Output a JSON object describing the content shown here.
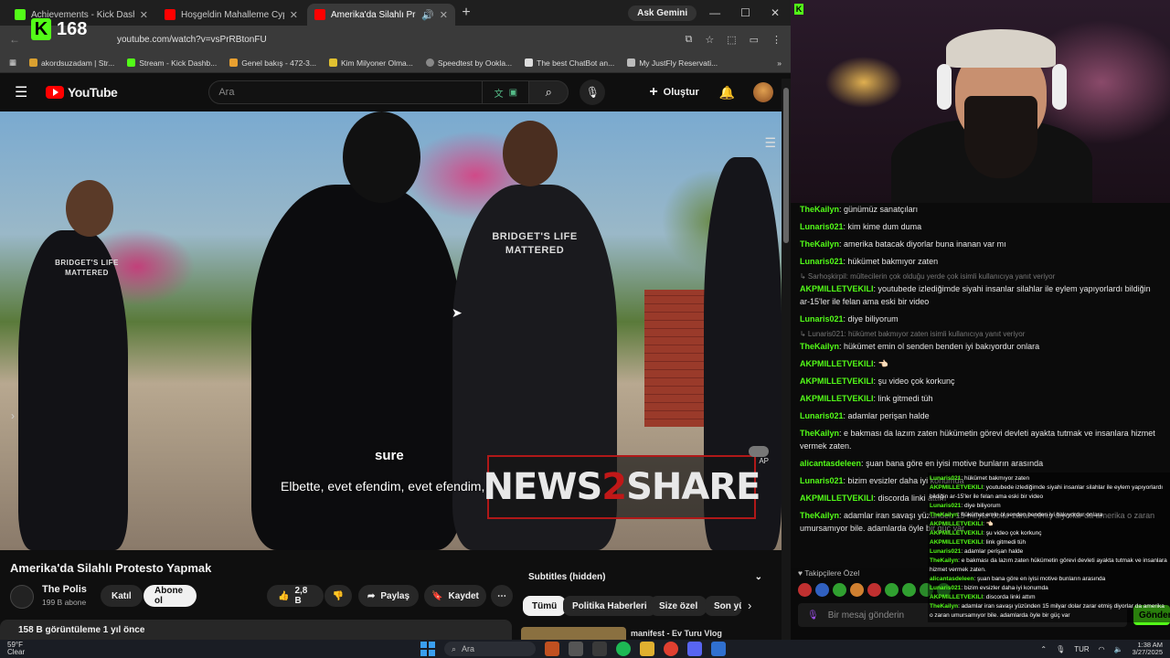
{
  "browser": {
    "tabs": [
      {
        "title": "Achievements - Kick Dashboard",
        "color": "#53fc18"
      },
      {
        "title": "Hoşgeldin Mahalleme Cypher -",
        "color": "#ff0000"
      },
      {
        "title": "Amerika'da Silahlı Protesto",
        "color": "#ff0000"
      }
    ],
    "ask_gemini": "Ask Gemini",
    "kick_badge": {
      "letter": "K",
      "count": "168"
    },
    "url": "youtube.com/watch?v=vsPrRBtonFU",
    "bookmarks": [
      "akordsuzadam | Str...",
      "Stream - Kick Dashb...",
      "Genel bakış - 472-3...",
      "Kim Milyoner Olma...",
      "Speedtest by Ookla...",
      "The best ChatBot an...",
      "My JustFly Reservati..."
    ]
  },
  "youtube": {
    "logo_text": "YouTube",
    "search_placeholder": "Ara",
    "create_label": "Oluştur",
    "video": {
      "subtitle_line1": "sure",
      "subtitle_line2": "Elbette, evet efendim, evet efendim,",
      "watermark_left": "NEWS",
      "watermark_num": "2",
      "watermark_right": "SHARE",
      "shirt_text_1": "BRIDGET'S LIFE MATTERED",
      "shirt_text_2": "BRIDGET'S LIFE MATTERED",
      "autoplay_label": "AP"
    },
    "title": "Amerika'da Silahlı Protesto Yapmak",
    "channel": {
      "name": "The Polis",
      "subscribers": "199 B abone"
    },
    "join_label": "Katıl",
    "subscribe_label": "Abone ol",
    "like_count": "2,8 B",
    "share_label": "Paylaş",
    "save_label": "Kaydet",
    "views_line": "158 B görüntüleme  1 yıl önce",
    "subtitles_panel": "Subtitles (hidden)",
    "chips": [
      "Tümü",
      "Politika Haberleri",
      "Size özel",
      "Son yü"
    ],
    "rec_title": "manifest - Ev Turu Vlog"
  },
  "chat": {
    "messages": [
      {
        "user": "TheKailyn",
        "color": "#53fc18",
        "text": "günümüz sanatçıları"
      },
      {
        "user": "Lunaris021",
        "color": "#53fc18",
        "text": "kim kime dum duma"
      },
      {
        "user": "TheKailyn",
        "color": "#53fc18",
        "text": "amerika batacak diyorlar buna inanan var mı"
      },
      {
        "user": "Lunaris021",
        "color": "#53fc18",
        "text": "hükümet bakmıyor zaten"
      },
      {
        "reply": "↳ Sarhoşkirpil: mültecilerin çok olduğu yerde çok isimli kullanıcıya yanıt veriyor"
      },
      {
        "user": "AKPMILLETVEKILI",
        "color": "#53fc18",
        "text": "youtubede izlediğimde siyahi insanlar silahlar ile eylem yapıyorlardı bildiğin ar-15'ler ile felan ama eski bir video"
      },
      {
        "user": "Lunaris021",
        "color": "#53fc18",
        "text": "diye biliyorum"
      },
      {
        "reply": "↳ Lunaris021: hükümet bakmıyor zaten isimli kullanıcıya yanıt veriyor"
      },
      {
        "user": "TheKailyn",
        "color": "#53fc18",
        "text": "hükümet emin ol senden benden iyi bakıyordur onlara"
      },
      {
        "user": "AKPMILLETVEKILI",
        "color": "#53fc18",
        "text": "👈🏻"
      },
      {
        "user": "AKPMILLETVEKILI",
        "color": "#53fc18",
        "text": "şu video çok korkunç"
      },
      {
        "user": "AKPMILLETVEKILI",
        "color": "#53fc18",
        "text": "link gitmedi tüh"
      },
      {
        "user": "Lunaris021",
        "color": "#53fc18",
        "text": "adamlar perişan halde"
      },
      {
        "user": "TheKailyn",
        "color": "#53fc18",
        "text": "e bakması da lazım zaten hükümetin görevi devleti ayakta tutmak ve insanlara hizmet vermek zaten."
      },
      {
        "user": "alicantasdeleen",
        "color": "#53fc18",
        "text": "şuan bana göre en iyisi motive bunların arasında"
      },
      {
        "user": "Lunaris021",
        "color": "#53fc18",
        "text": "bizim evsizler daha iyi konumda"
      },
      {
        "user": "AKPMILLETVEKILI",
        "color": "#53fc18",
        "text": "discorda linki attım"
      },
      {
        "user": "TheKailyn",
        "color": "#53fc18",
        "text": "adamlar iran savaşı yüzünden 15 milyar dolar zarar etmiş diyorlar da amerika o zaran umursamıyor bile. adamlarda öyle bir güç var"
      }
    ],
    "overlay": [
      {
        "user": "Lunaris021",
        "text": "hükümet bakmıyor zaten"
      },
      {
        "user": "AKPMILLETVEKILI",
        "text": "youtubede izlediğimde siyahi insanlar silahlar ile eylem yapıyorlardı bildiğin ar-15'ler ile felan ama eski bir video"
      },
      {
        "user": "Lunaris021",
        "text": "diye biliyorum"
      },
      {
        "user": "TheKailyn",
        "text": "hükümet emin ol senden benden iyi bakıyordur onlara"
      },
      {
        "user": "AKPMILLETVEKILI",
        "text": "👈🏻"
      },
      {
        "user": "AKPMILLETVEKILI",
        "text": "şu video çok korkunç"
      },
      {
        "user": "AKPMILLETVEKILI",
        "text": "link gitmedi tüh"
      },
      {
        "user": "Lunaris021",
        "text": "adamlar perişan halde"
      },
      {
        "user": "TheKailyn",
        "text": "e bakması da lazım zaten hükümetin görevi devleti ayakta tutmak ve insanlara hizmet vermek zaten."
      },
      {
        "user": "alicantasdeleen",
        "text": "şuan bana göre en iyisi motive bunların arasında"
      },
      {
        "user": "Lunaris021",
        "text": "bizim evsizler daha iyi konumda"
      },
      {
        "user": "AKPMILLETVEKILI",
        "text": "discorda linki attım"
      },
      {
        "user": "TheKailyn",
        "text": "adamlar iran savaşı yüzünden 15 milyar dolar zarar etmiş diyorlar da amerika o zaran umursamıyor bile. adamlarda öyle bir güç var"
      }
    ],
    "followers_only_label": "Takipçilere Özel",
    "input_placeholder": "Bir mesaj gönderin",
    "send_label": "Gönder"
  },
  "taskbar": {
    "weather_temp": "59°F",
    "weather_desc": "Clear",
    "search_label": "Ara",
    "lang": "TUR",
    "time": "1:38 AM",
    "date": "3/27/2025"
  }
}
